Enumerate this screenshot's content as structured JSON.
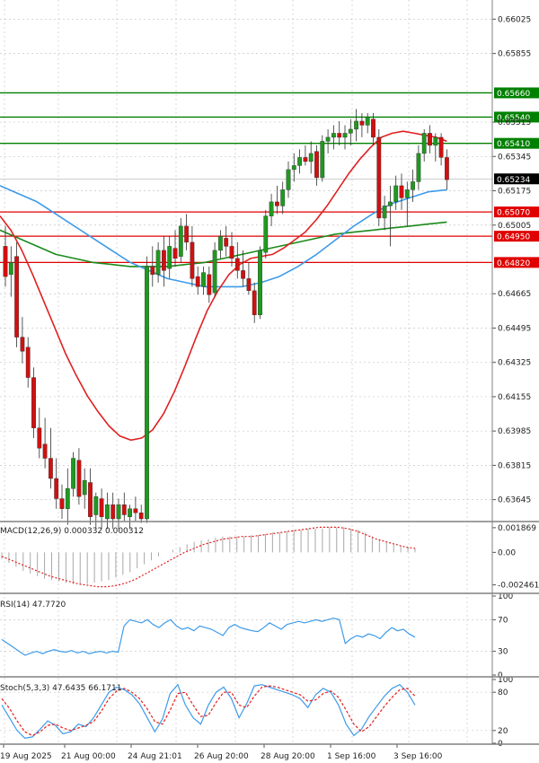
{
  "chart_data": {
    "type": "candlestick",
    "main": {
      "price_axis_ticks": [
        "0.66025",
        "0.65855",
        "0.65515",
        "0.65345",
        "0.65175",
        "0.65005",
        "0.64665",
        "0.64495",
        "0.64325",
        "0.64155",
        "0.63985",
        "0.63815",
        "0.63645"
      ],
      "ylim": [
        0.6355,
        0.6612
      ],
      "current_price": "0.65234",
      "levels": [
        {
          "label": "0.65660",
          "value": 0.6566,
          "color": "#008000"
        },
        {
          "label": "0.65540",
          "value": 0.6554,
          "color": "#008000"
        },
        {
          "label": "0.65410",
          "value": 0.6541,
          "color": "#008000"
        },
        {
          "label": "0.65070",
          "value": 0.6507,
          "color": "#e00000"
        },
        {
          "label": "0.64950",
          "value": 0.6495,
          "color": "#e00000"
        },
        {
          "label": "0.64820",
          "value": 0.6482,
          "color": "#e00000"
        }
      ],
      "ohlc": [
        [
          0.649,
          0.65,
          0.647,
          0.6475
        ],
        [
          0.6476,
          0.649,
          0.6465,
          0.6482
        ],
        [
          0.6485,
          0.6492,
          0.644,
          0.6445
        ],
        [
          0.6445,
          0.6455,
          0.6432,
          0.6438
        ],
        [
          0.644,
          0.6445,
          0.642,
          0.6425
        ],
        [
          0.6425,
          0.643,
          0.6395,
          0.64
        ],
        [
          0.64,
          0.641,
          0.6385,
          0.639
        ],
        [
          0.6392,
          0.6405,
          0.638,
          0.6385
        ],
        [
          0.6385,
          0.64,
          0.637,
          0.6375
        ],
        [
          0.6375,
          0.6385,
          0.636,
          0.6365
        ],
        [
          0.6365,
          0.6372,
          0.6355,
          0.636
        ],
        [
          0.636,
          0.638,
          0.6352,
          0.637
        ],
        [
          0.637,
          0.6388,
          0.6366,
          0.6385
        ],
        [
          0.6384,
          0.639,
          0.6362,
          0.6366
        ],
        [
          0.6367,
          0.638,
          0.636,
          0.6374
        ],
        [
          0.6373,
          0.638,
          0.6352,
          0.6356
        ],
        [
          0.6357,
          0.6368,
          0.635,
          0.6366
        ],
        [
          0.6365,
          0.637,
          0.635,
          0.6356
        ],
        [
          0.6355,
          0.6368,
          0.635,
          0.6362
        ],
        [
          0.6362,
          0.6368,
          0.635,
          0.6355
        ],
        [
          0.6355,
          0.6365,
          0.635,
          0.6362
        ],
        [
          0.6362,
          0.6368,
          0.6354,
          0.6357
        ],
        [
          0.6356,
          0.6362,
          0.635,
          0.636
        ],
        [
          0.636,
          0.6366,
          0.6354,
          0.6358
        ],
        [
          0.6358,
          0.6362,
          0.6353,
          0.6355
        ],
        [
          0.6355,
          0.6485,
          0.6353,
          0.648
        ],
        [
          0.648,
          0.649,
          0.647,
          0.6476
        ],
        [
          0.6476,
          0.6492,
          0.6472,
          0.6488
        ],
        [
          0.6488,
          0.6495,
          0.647,
          0.6478
        ],
        [
          0.6479,
          0.6495,
          0.6474,
          0.649
        ],
        [
          0.6489,
          0.6498,
          0.648,
          0.6484
        ],
        [
          0.6485,
          0.6504,
          0.6482,
          0.65
        ],
        [
          0.65,
          0.6506,
          0.6488,
          0.6492
        ],
        [
          0.6492,
          0.65,
          0.647,
          0.6474
        ],
        [
          0.6475,
          0.648,
          0.6466,
          0.647
        ],
        [
          0.647,
          0.648,
          0.6466,
          0.6477
        ],
        [
          0.6476,
          0.648,
          0.6462,
          0.6466
        ],
        [
          0.6467,
          0.6492,
          0.6465,
          0.6488
        ],
        [
          0.6488,
          0.6498,
          0.6484,
          0.6495
        ],
        [
          0.6494,
          0.65,
          0.6485,
          0.649
        ],
        [
          0.649,
          0.6497,
          0.648,
          0.6484
        ],
        [
          0.6484,
          0.6492,
          0.6474,
          0.6478
        ],
        [
          0.6478,
          0.6488,
          0.647,
          0.6474
        ],
        [
          0.6474,
          0.6482,
          0.6466,
          0.6468
        ],
        [
          0.6468,
          0.6472,
          0.6452,
          0.6456
        ],
        [
          0.6456,
          0.649,
          0.6454,
          0.6488
        ],
        [
          0.6487,
          0.6508,
          0.6484,
          0.6505
        ],
        [
          0.6505,
          0.6516,
          0.65,
          0.6512
        ],
        [
          0.6512,
          0.652,
          0.6506,
          0.651
        ],
        [
          0.651,
          0.6522,
          0.6506,
          0.6518
        ],
        [
          0.6518,
          0.6532,
          0.6514,
          0.6528
        ],
        [
          0.6528,
          0.6536,
          0.6522,
          0.653
        ],
        [
          0.653,
          0.6538,
          0.6526,
          0.6534
        ],
        [
          0.6534,
          0.654,
          0.653,
          0.6532
        ],
        [
          0.6532,
          0.6542,
          0.6526,
          0.6536
        ],
        [
          0.6537,
          0.654,
          0.652,
          0.6524
        ],
        [
          0.6524,
          0.6545,
          0.6522,
          0.6542
        ],
        [
          0.6542,
          0.6548,
          0.6536,
          0.6544
        ],
        [
          0.6544,
          0.655,
          0.6538,
          0.6546
        ],
        [
          0.6546,
          0.6552,
          0.654,
          0.6544
        ],
        [
          0.6544,
          0.655,
          0.6538,
          0.6546
        ],
        [
          0.6546,
          0.6553,
          0.654,
          0.6548
        ],
        [
          0.6548,
          0.6558,
          0.6542,
          0.6552
        ],
        [
          0.6552,
          0.6556,
          0.6544,
          0.655
        ],
        [
          0.655,
          0.6556,
          0.6546,
          0.6554
        ],
        [
          0.6553,
          0.6556,
          0.654,
          0.6544
        ],
        [
          0.6544,
          0.6548,
          0.65,
          0.6504
        ],
        [
          0.6504,
          0.6515,
          0.6498,
          0.651
        ],
        [
          0.651,
          0.652,
          0.649,
          0.6512
        ],
        [
          0.6512,
          0.6525,
          0.6508,
          0.652
        ],
        [
          0.652,
          0.6526,
          0.6508,
          0.6514
        ],
        [
          0.6514,
          0.6522,
          0.65,
          0.6518
        ],
        [
          0.6518,
          0.6528,
          0.6512,
          0.6522
        ],
        [
          0.6522,
          0.654,
          0.6518,
          0.6536
        ],
        [
          0.6536,
          0.6548,
          0.6532,
          0.6546
        ],
        [
          0.6546,
          0.655,
          0.6536,
          0.654
        ],
        [
          0.654,
          0.6546,
          0.6532,
          0.6544
        ],
        [
          0.6544,
          0.6546,
          0.653,
          0.6534
        ],
        [
          0.6534,
          0.6538,
          0.6518,
          0.6523
        ]
      ],
      "ma_red": [
        0.6505,
        0.6498,
        0.6488,
        0.6476,
        0.6463,
        0.645,
        0.6437,
        0.6426,
        0.6416,
        0.6408,
        0.6401,
        0.6396,
        0.6394,
        0.6395,
        0.6399,
        0.6407,
        0.6418,
        0.6431,
        0.6445,
        0.6458,
        0.6468,
        0.6476,
        0.6481,
        0.6484,
        0.6485,
        0.6486,
        0.6489,
        0.6493,
        0.6497,
        0.6503,
        0.651,
        0.6518,
        0.6526,
        0.6533,
        0.6539,
        0.6544,
        0.6546,
        0.6547,
        0.6546,
        0.6545,
        0.6544,
        0.6542
      ],
      "ma_blue": [
        0.652,
        0.6516,
        0.6512,
        0.6506,
        0.65,
        0.6494,
        0.6488,
        0.6482,
        0.6478,
        0.6474,
        0.6472,
        0.647,
        0.647,
        0.647,
        0.6472,
        0.6475,
        0.648,
        0.6486,
        0.6493,
        0.65,
        0.6506,
        0.6511,
        0.6514,
        0.6517,
        0.6518
      ],
      "ma_green": [
        0.6498,
        0.6494,
        0.649,
        0.6486,
        0.6484,
        0.6482,
        0.6481,
        0.648,
        0.648,
        0.648,
        0.6481,
        0.6482,
        0.6484,
        0.6486,
        0.6488,
        0.649,
        0.6492,
        0.6494,
        0.6496,
        0.6497,
        0.6498,
        0.6499,
        0.65,
        0.6501,
        0.6502
      ]
    },
    "macd": {
      "label": "MACD(12,26,9) 0.000332 0.000312",
      "ticks": [
        "0.001869",
        "0.00",
        "-0.002461"
      ],
      "ylim": [
        -0.0029,
        0.0022
      ],
      "hist": [
        -0.0005,
        -0.0008,
        -0.0011,
        -0.0014,
        -0.0016,
        -0.0018,
        -0.002,
        -0.0021,
        -0.0022,
        -0.0023,
        -0.0024,
        -0.0024,
        -0.0024,
        -0.0023,
        -0.0022,
        -0.0021,
        -0.0019,
        -0.0017,
        -0.0015,
        -0.0012,
        -0.0009,
        -0.0006,
        -0.0003,
        0.0,
        0.0002,
        0.0004,
        0.0006,
        0.0008,
        0.0009,
        0.001,
        0.0011,
        0.0012,
        0.0012,
        0.0012,
        0.0012,
        0.0013,
        0.0013,
        0.0014,
        0.0015,
        0.0015,
        0.0016,
        0.0017,
        0.0017,
        0.0018,
        0.0018,
        0.0018,
        0.0019,
        0.0019,
        0.0019,
        0.0018,
        0.0017,
        0.0015,
        0.0012,
        0.001,
        0.0008,
        0.0006,
        0.0005,
        0.0004,
        0.0003
      ],
      "signal": [
        -0.0003,
        -0.0006,
        -0.0009,
        -0.0012,
        -0.0015,
        -0.0018,
        -0.002,
        -0.0022,
        -0.0024,
        -0.0025,
        -0.0026,
        -0.0026,
        -0.0025,
        -0.0023,
        -0.002,
        -0.0016,
        -0.0012,
        -0.0008,
        -0.0004,
        0.0,
        0.0003,
        0.0006,
        0.0008,
        0.001,
        0.0011,
        0.0012,
        0.0012,
        0.0013,
        0.0014,
        0.0015,
        0.0016,
        0.0017,
        0.0018,
        0.0019,
        0.0019,
        0.0019,
        0.0018,
        0.0016,
        0.0013,
        0.001,
        0.0008,
        0.0006,
        0.0004,
        0.0003
      ]
    },
    "rsi": {
      "label": "RSI(14) 47.7720",
      "ticks": [
        "100",
        "70",
        "30",
        "0"
      ],
      "ylim": [
        0,
        100
      ],
      "values": [
        45,
        40,
        35,
        30,
        25,
        28,
        30,
        27,
        30,
        32,
        30,
        29,
        31,
        28,
        30,
        27,
        29,
        30,
        28,
        30,
        29,
        62,
        70,
        68,
        66,
        70,
        64,
        60,
        66,
        70,
        62,
        58,
        60,
        56,
        62,
        60,
        58,
        54,
        50,
        60,
        64,
        60,
        58,
        56,
        55,
        60,
        66,
        62,
        58,
        64,
        66,
        68,
        66,
        68,
        70,
        68,
        70,
        72,
        70,
        40,
        46,
        50,
        48,
        52,
        50,
        46,
        54,
        60,
        56,
        58,
        52,
        48
      ]
    },
    "stoch": {
      "label": "Stoch(5,3,3) 47.6435 66.1711",
      "ticks": [
        "100",
        "80",
        "20",
        "0"
      ],
      "ylim": [
        0,
        100
      ],
      "k": [
        60,
        40,
        20,
        8,
        10,
        22,
        35,
        28,
        15,
        18,
        30,
        26,
        40,
        60,
        80,
        88,
        84,
        76,
        62,
        40,
        18,
        38,
        78,
        92,
        60,
        40,
        30,
        60,
        80,
        88,
        70,
        40,
        62,
        90,
        92,
        88,
        84,
        80,
        76,
        70,
        56,
        76,
        86,
        80,
        60,
        30,
        12,
        22,
        42,
        58,
        74,
        86,
        92,
        80,
        60
      ],
      "d": [
        70,
        55,
        35,
        18,
        12,
        18,
        28,
        30,
        24,
        20,
        24,
        28,
        34,
        50,
        70,
        82,
        86,
        80,
        70,
        54,
        34,
        30,
        52,
        78,
        80,
        60,
        42,
        44,
        64,
        80,
        80,
        60,
        56,
        74,
        88,
        90,
        88,
        84,
        80,
        76,
        66,
        68,
        78,
        82,
        72,
        52,
        30,
        18,
        26,
        42,
        58,
        72,
        84,
        86,
        74
      ]
    },
    "x_ticks": [
      "19 Aug 2025",
      "21 Aug 00:00",
      "24 Aug 21:01",
      "26 Aug 20:00",
      "28 Aug 20:00",
      "1 Sep 16:00",
      "3 Sep 16:00"
    ]
  }
}
